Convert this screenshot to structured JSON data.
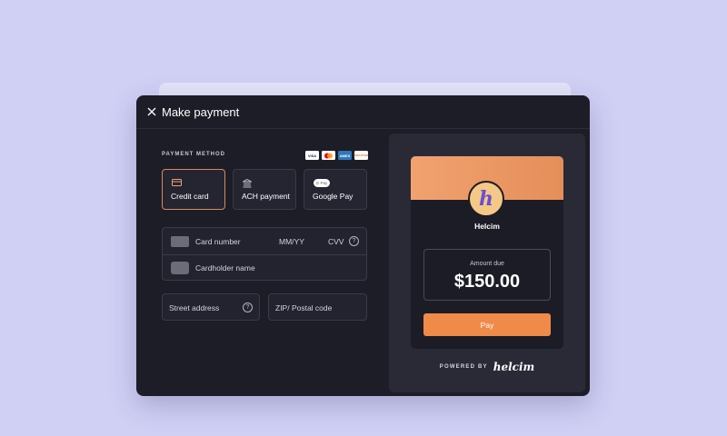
{
  "modal": {
    "title": "Make payment"
  },
  "payment_method": {
    "section_label": "PAYMENT METHOD",
    "accepted_cards": [
      {
        "name": "visa-logo",
        "text": "VISA"
      },
      {
        "name": "mastercard-logo",
        "text": ""
      },
      {
        "name": "amex-logo",
        "text": "AMEX"
      },
      {
        "name": "discover-logo",
        "text": "DISCOVER"
      }
    ],
    "options": [
      {
        "label": "Credit card",
        "icon": "credit-card-icon",
        "selected": true
      },
      {
        "label": "ACH payment",
        "icon": "bank-icon",
        "selected": false
      },
      {
        "label": "Google Pay",
        "icon": "google-pay-icon",
        "selected": false
      }
    ],
    "gpay_badge": "G Pay"
  },
  "card_form": {
    "card_number_placeholder": "Card number",
    "expiry_placeholder": "MM/YY",
    "cvv_placeholder": "CVV",
    "cardholder_placeholder": "Cardholder name",
    "street_placeholder": "Street address",
    "zip_placeholder": "ZIP/ Postal code",
    "help_glyph": "?"
  },
  "summary": {
    "brand_initial": "h",
    "brand_name": "Helcim",
    "amount_label": "Amount due",
    "amount": "$150.00",
    "pay_label": "Pay",
    "powered_by": "POWERED BY",
    "powered_brand": "helcim"
  },
  "colors": {
    "background": "#d0d0f5",
    "modal": "#1d1d27",
    "accent": "#f08a48",
    "brand_gradient": "#f1a26f"
  }
}
